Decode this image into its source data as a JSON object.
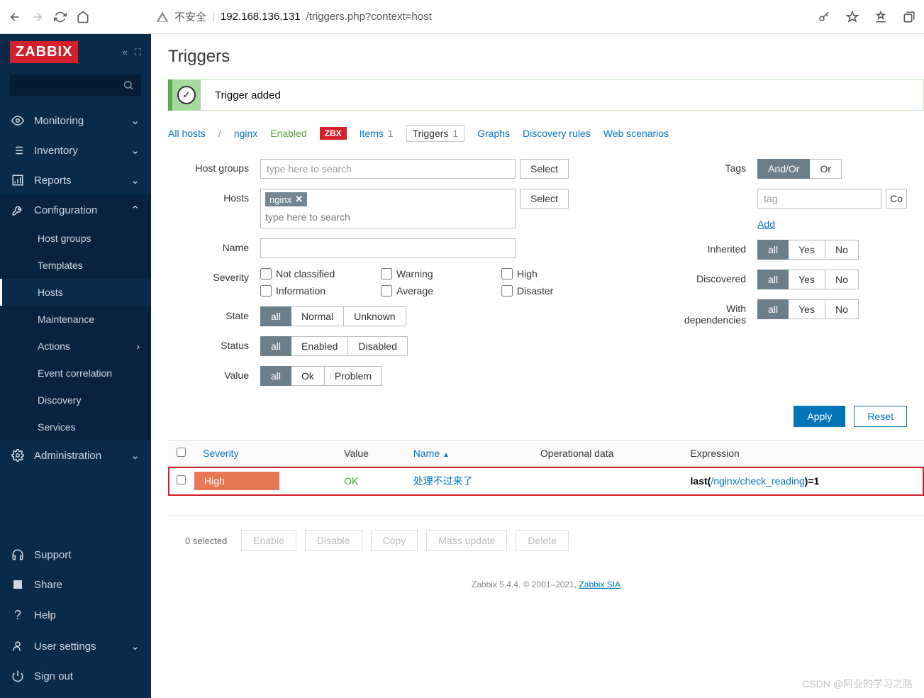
{
  "browser": {
    "insecure_label": "不安全",
    "url_host": "192.168.136.131",
    "url_path": "/triggers.php?context=host"
  },
  "logo": "ZABBIX",
  "sidebar": {
    "items": [
      {
        "label": "Monitoring"
      },
      {
        "label": "Inventory"
      },
      {
        "label": "Reports"
      },
      {
        "label": "Configuration"
      },
      {
        "label": "Administration"
      }
    ],
    "config_sub": [
      {
        "label": "Host groups"
      },
      {
        "label": "Templates"
      },
      {
        "label": "Hosts"
      },
      {
        "label": "Maintenance"
      },
      {
        "label": "Actions"
      },
      {
        "label": "Event correlation"
      },
      {
        "label": "Discovery"
      },
      {
        "label": "Services"
      }
    ],
    "bottom": [
      {
        "label": "Support"
      },
      {
        "label": "Share"
      },
      {
        "label": "Help"
      },
      {
        "label": "User settings"
      },
      {
        "label": "Sign out"
      }
    ]
  },
  "page": {
    "title": "Triggers",
    "alert": "Trigger added"
  },
  "tabs": {
    "all_hosts": "All hosts",
    "host": "nginx",
    "enabled": "Enabled",
    "zbx": "ZBX",
    "items": "Items",
    "items_count": "1",
    "triggers": "Triggers",
    "triggers_count": "1",
    "graphs": "Graphs",
    "discovery": "Discovery rules",
    "web": "Web scenarios"
  },
  "filter": {
    "host_groups_label": "Host groups",
    "host_groups_ph": "type here to search",
    "hosts_label": "Hosts",
    "hosts_tag": "nginx",
    "hosts_ph": "type here to search",
    "name_label": "Name",
    "severity_label": "Severity",
    "sev": {
      "nc": "Not classified",
      "warn": "Warning",
      "high": "High",
      "info": "Information",
      "avg": "Average",
      "dis": "Disaster"
    },
    "state_label": "State",
    "state": {
      "all": "all",
      "normal": "Normal",
      "unknown": "Unknown"
    },
    "status_label": "Status",
    "status": {
      "all": "all",
      "enabled": "Enabled",
      "disabled": "Disabled"
    },
    "value_label": "Value",
    "value": {
      "all": "all",
      "ok": "Ok",
      "problem": "Problem"
    },
    "tags_label": "Tags",
    "tags_mode": {
      "andor": "And/Or",
      "or": "Or"
    },
    "tag_ph": "tag",
    "contains_btn": "Co",
    "add_link": "Add",
    "inherited_label": "Inherited",
    "discovered_label": "Discovered",
    "deps_label": "With dependencies",
    "tri": {
      "all": "all",
      "yes": "Yes",
      "no": "No"
    },
    "select_btn": "Select",
    "apply": "Apply",
    "reset": "Reset"
  },
  "table": {
    "headers": {
      "severity": "Severity",
      "value": "Value",
      "name": "Name",
      "opdata": "Operational data",
      "expression": "Expression"
    },
    "row": {
      "severity": "High",
      "value": "OK",
      "name": "处理不过来了",
      "expr_prefix": "last(",
      "expr_link": "/nginx/check_reading",
      "expr_suffix": ")=1"
    }
  },
  "bottom": {
    "selected": "0 selected",
    "enable": "Enable",
    "disable": "Disable",
    "copy": "Copy",
    "mass": "Mass update",
    "delete": "Delete"
  },
  "footer": {
    "text": "Zabbix 5.4.4. © 2001–2021, ",
    "link": "Zabbix SIA"
  },
  "watermark": "CSDN @阿业的学习之路"
}
